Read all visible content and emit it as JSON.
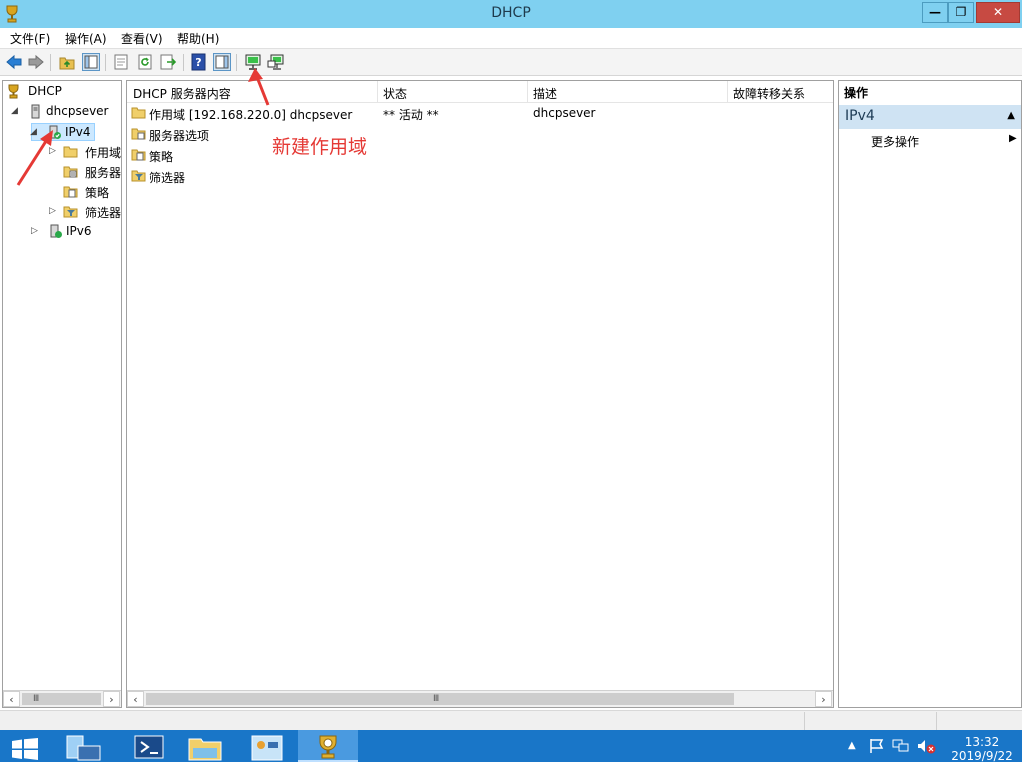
{
  "window": {
    "title": "DHCP",
    "min_glyph": "—",
    "max_glyph": "❐",
    "close_glyph": "✕"
  },
  "menu": [
    "文件(F)",
    "操作(A)",
    "查看(V)",
    "帮助(H)"
  ],
  "toolbar": {
    "icons": [
      "back-icon",
      "forward-icon",
      "up-folder-icon",
      "show-hide-tree-icon",
      "properties-icon",
      "refresh-icon",
      "export-list-icon",
      "help-icon",
      "show-hide-action-pane-icon",
      "new-scope-icon",
      "server-icon"
    ]
  },
  "tree": {
    "items": [
      {
        "label": "DHCP"
      },
      {
        "label": "dhcpsever",
        "expander": "◢"
      },
      {
        "label": "IPv4",
        "expander": "◢"
      },
      {
        "label": "作用域",
        "expander": "▷"
      },
      {
        "label": "服务器"
      },
      {
        "label": "策略"
      },
      {
        "label": "筛选器",
        "expander": "▷"
      },
      {
        "label": "IPv6",
        "expander": "▷"
      }
    ],
    "scroll_grip": "Ⅲ"
  },
  "list": {
    "columns": [
      "DHCP 服务器内容",
      "状态",
      "描述",
      "故障转移关系"
    ],
    "rows": [
      {
        "name": "作用域 [192.168.220.0] dhcpsever",
        "status": "** 活动 **",
        "desc": "dhcpsever"
      },
      {
        "name": "服务器选项"
      },
      {
        "name": "策略"
      },
      {
        "name": "筛选器"
      }
    ],
    "scroll_grip": "Ⅲ"
  },
  "actions": {
    "header": "操作",
    "section": "IPv4",
    "items": [
      "更多操作"
    ]
  },
  "annotation": {
    "text": "新建作用域",
    "color": "#e53935"
  },
  "taskbar": {
    "time": "13:32",
    "date": "2019/9/22"
  },
  "colors": {
    "titlebar": "#7fd0f0",
    "taskbar": "#1976c8",
    "close": "#c74a42",
    "action_section": "#cfe3f3"
  }
}
